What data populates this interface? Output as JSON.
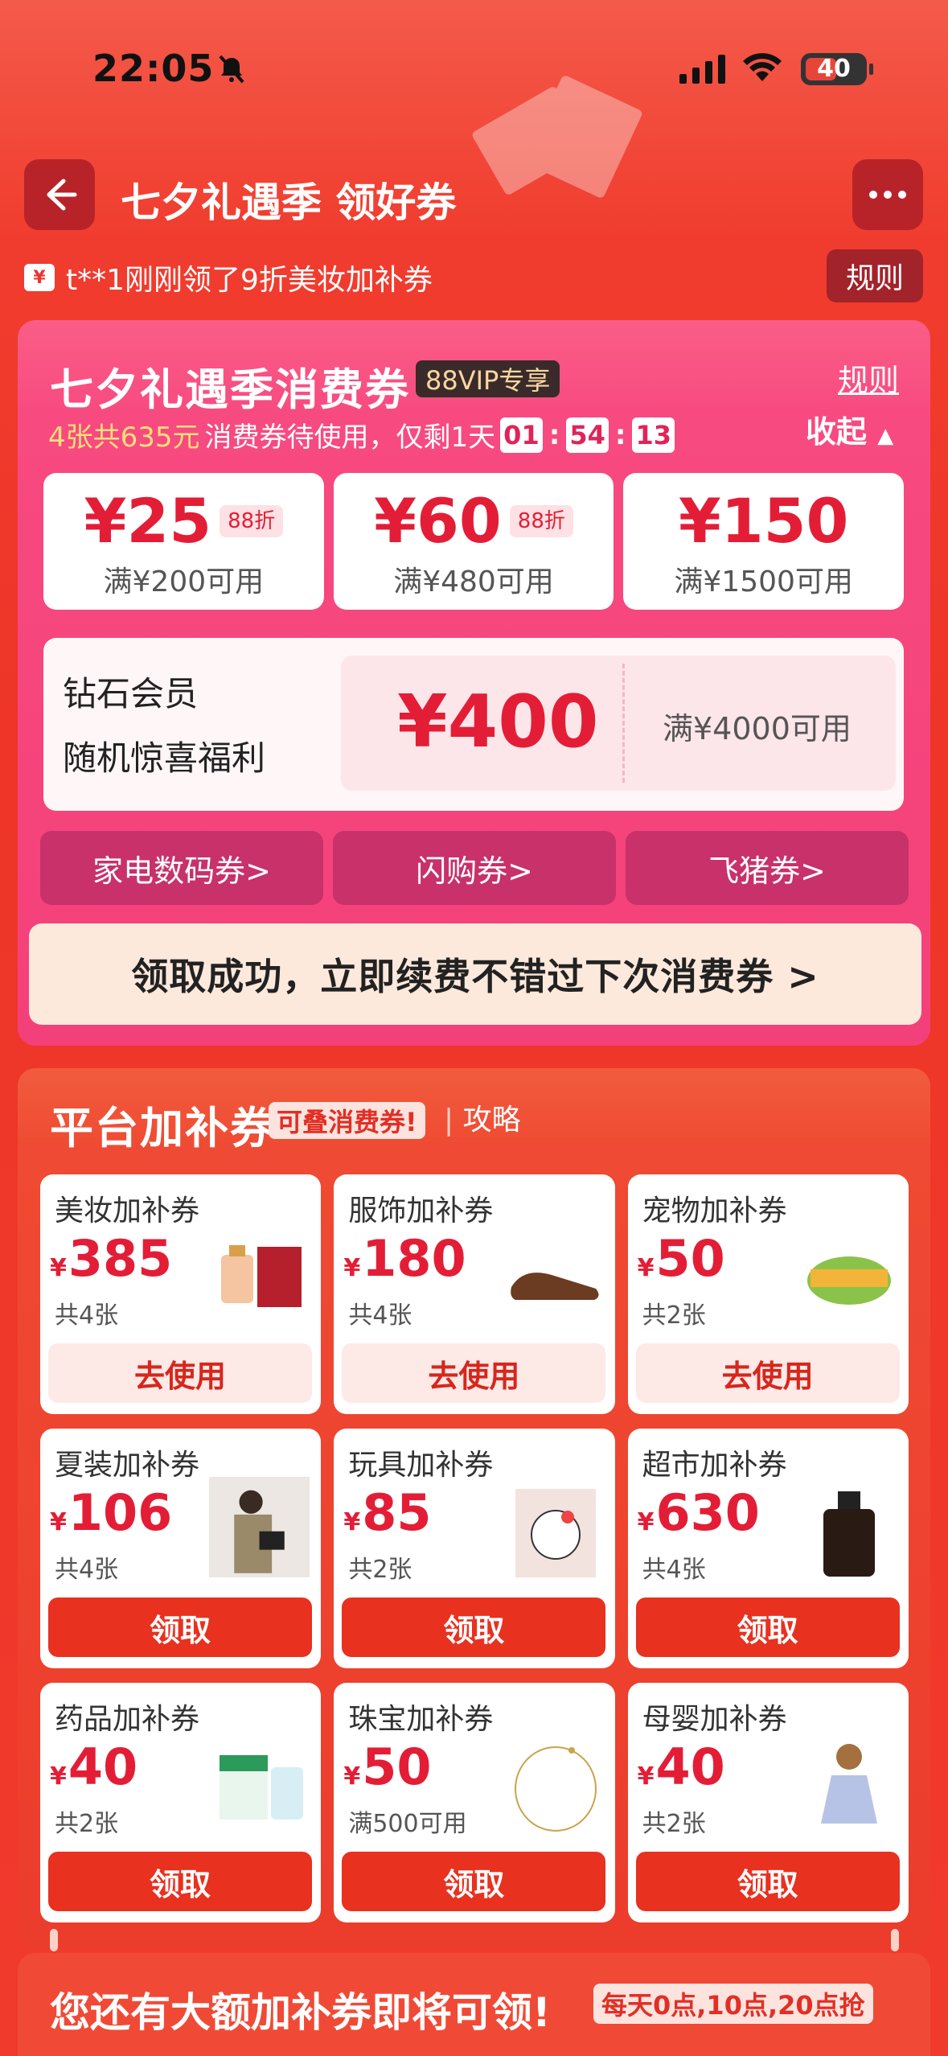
{
  "status_bar": {
    "time": "22:05",
    "battery": "40"
  },
  "nav": {
    "title": "七夕礼遇季 领好券",
    "rule": "规则"
  },
  "ticker": {
    "icon": "¥",
    "text": "t**1刚刚领了9折美妆加补券"
  },
  "consumption": {
    "title": "七夕礼遇季消费券",
    "badge": "88VIP专享",
    "rule": "规则",
    "sub_pre": "4张共635元",
    "sub_mid": "消费券待使用，仅剩1天",
    "timer": {
      "h": "01",
      "m": "54",
      "s": "13"
    },
    "collapse": "收起",
    "coupons": [
      {
        "amount": "¥25",
        "tag": "88折",
        "cond": "满¥200可用"
      },
      {
        "amount": "¥60",
        "tag": "88折",
        "cond": "满¥480可用"
      },
      {
        "amount": "¥150",
        "tag": "",
        "cond": "满¥1500可用"
      }
    ],
    "diamond": {
      "line1": "钻石会员",
      "line2": "随机惊喜福利",
      "amount": "¥400",
      "cond": "满¥4000可用"
    },
    "categories": [
      "家电数码券>",
      "闪购券>",
      "飞猪券>"
    ],
    "success": "领取成功，立即续费不错过下次消费券 >"
  },
  "platform": {
    "title": "平台加补券",
    "tag": "可叠消费券!",
    "guide": "攻略",
    "items": [
      {
        "name": "美妆加补券",
        "cur": "¥",
        "amount": "385",
        "count": "共4张",
        "btn": "去使用",
        "icon": "perfume-icon"
      },
      {
        "name": "服饰加补券",
        "cur": "¥",
        "amount": "180",
        "count": "共4张",
        "btn": "去使用",
        "icon": "shoe-icon"
      },
      {
        "name": "宠物加补券",
        "cur": "¥",
        "amount": "50",
        "count": "共2张",
        "btn": "去使用",
        "icon": "petfood-icon"
      },
      {
        "name": "夏装加补券",
        "cur": "¥",
        "amount": "106",
        "count": "共4张",
        "btn": "领取",
        "icon": "summer-wear-icon"
      },
      {
        "name": "玩具加补券",
        "cur": "¥",
        "amount": "85",
        "count": "共2张",
        "btn": "领取",
        "icon": "toy-icon"
      },
      {
        "name": "超市加补券",
        "cur": "¥",
        "amount": "630",
        "count": "共4张",
        "btn": "领取",
        "icon": "bottle-icon"
      },
      {
        "name": "药品加补券",
        "cur": "¥",
        "amount": "40",
        "count": "共2张",
        "btn": "领取",
        "icon": "medicine-icon"
      },
      {
        "name": "珠宝加补券",
        "cur": "¥",
        "amount": "50",
        "count": "满500可用",
        "btn": "领取",
        "icon": "necklace-icon"
      },
      {
        "name": "母婴加补券",
        "cur": "¥",
        "amount": "40",
        "count": "共2张",
        "btn": "领取",
        "icon": "child-icon"
      }
    ]
  },
  "bottom": {
    "title": "您还有大额加补券即将可领!",
    "tag": "每天0点,10点,20点抢"
  },
  "colors": {
    "primary_red": "#e41d36",
    "pink": "#f4407a",
    "orange_red": "#ec3c2b"
  }
}
